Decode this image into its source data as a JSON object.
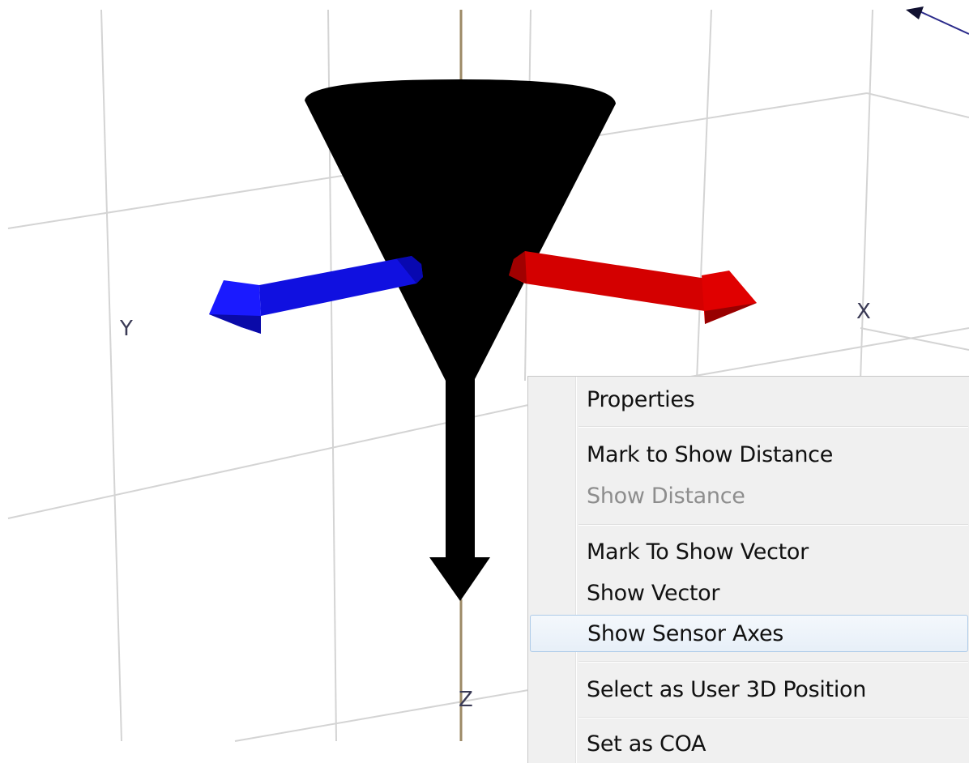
{
  "viewport": {
    "axis_labels": {
      "x": "X",
      "y": "Y",
      "z": "Z"
    },
    "colors": {
      "background": "#ffffff",
      "grid": "#d4d4d4",
      "z_axis_line": "#9c8a66",
      "sensor_body": "#000000",
      "x_arrow": "#d40000",
      "y_arrow": "#1010e0",
      "z_arrow": "#000000",
      "axis_label": "#3a3a55"
    }
  },
  "context_menu": {
    "items": [
      {
        "label": "Properties",
        "enabled": true
      },
      {
        "label": "Mark to Show Distance",
        "enabled": true
      },
      {
        "label": "Show Distance",
        "enabled": false
      },
      {
        "label": "Mark To Show Vector",
        "enabled": true
      },
      {
        "label": "Show Vector",
        "enabled": true
      },
      {
        "label": "Show Sensor Axes",
        "enabled": true,
        "highlighted": true
      },
      {
        "label": "Select as User 3D Position",
        "enabled": true
      },
      {
        "label": "Set as COA",
        "enabled": true
      }
    ]
  }
}
